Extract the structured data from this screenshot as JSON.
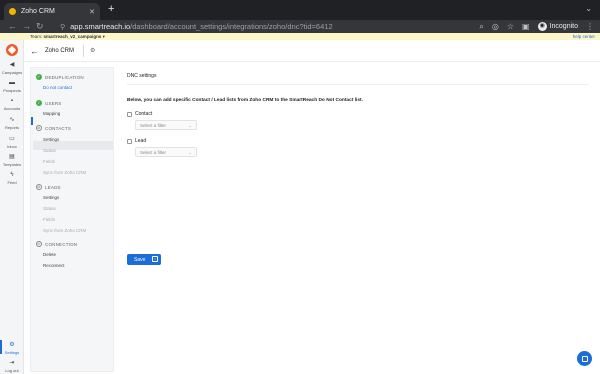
{
  "browser": {
    "tab_title": "Zoho CRM",
    "url_host": "app.smartreach.io",
    "url_path": "/dashboard/account_settings/integrations/zoho/dnc?tid=6412",
    "profile_label": "Incognito",
    "icons": [
      "search-icon",
      "eye-off-icon",
      "star-icon",
      "sidepanel-icon",
      "profile-icon",
      "more-icon"
    ]
  },
  "app": {
    "team_prefix": "Team:",
    "team_name": "smartreach_v2_campaigns",
    "team_chevron": "▾",
    "help_label": "help center",
    "page_title": "Zoho CRM"
  },
  "leftnav": {
    "items": [
      {
        "label": "Campaigns",
        "icon": "megaphone-icon"
      },
      {
        "label": "Prospects",
        "icon": "people-icon"
      },
      {
        "label": "Accounts",
        "icon": "building-icon"
      },
      {
        "label": "Inbox",
        "icon": "inbox-icon"
      },
      {
        "label": "Reports",
        "icon": "chart-icon"
      },
      {
        "label": "Templates",
        "icon": "template-icon"
      },
      {
        "label": "Feed",
        "icon": "bolt-icon"
      }
    ],
    "settings_label": "Settings",
    "logout_label": "Log out"
  },
  "settings_nav": {
    "deduplication": {
      "title": "DEDUPLICATION",
      "items": [
        "Do not contact"
      ]
    },
    "users": {
      "title": "USERS",
      "items": [
        "Mapping"
      ]
    },
    "contacts": {
      "title": "CONTACTS",
      "items": [
        "Settings",
        "Status",
        "Fields",
        "Sync from Zoho CRM"
      ]
    },
    "leads": {
      "title": "LEADS",
      "items": [
        "Settings",
        "Status",
        "Fields",
        "Sync from Zoho CRM"
      ]
    },
    "connection": {
      "title": "CONNECTION",
      "items": [
        "Delete",
        "Reconnect"
      ]
    }
  },
  "content": {
    "title": "DNC settings",
    "description": "Below, you can add specific Contact / Lead lists from Zoho CRM to the SmartReach Do Not Contact list.",
    "contact_label": "Contact",
    "lead_label": "Lead",
    "filter_placeholder": "Select a filter",
    "save_label": "Save"
  }
}
